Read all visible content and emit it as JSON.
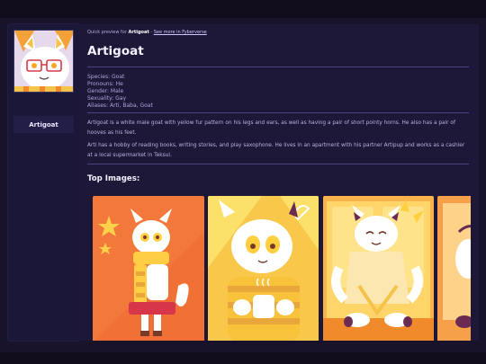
{
  "sidebar": {
    "character_name": "Artigoat"
  },
  "breadcrumb": {
    "prefix": "Quick preview for",
    "name": "Artigoat",
    "separator": " - ",
    "link": "See more in Fyberverse"
  },
  "character": {
    "name": "Artigoat",
    "facts": [
      "Species: Goat",
      "Pronouns: He",
      "Gender: Male",
      "Sexuality: Gay",
      "Aliases: Arti, Baba, Goat"
    ],
    "description_1": "Artigoat is a white male goat with yellow fur pattern on his legs and ears, as well as having a pair of short pointy horns. He also has a pair of hooves as his feet.",
    "description_2": "Arti has a hobby of reading books, writing stories, and play saxophone. He lives in an apartment with his partner Artipup and works as a cashier at a local supermarket in Teksul."
  },
  "gallery": {
    "title": "Top Images:"
  },
  "colors": {
    "accent": "#ff8a3c",
    "background": "#1d1838",
    "text": "#b9b1e0"
  }
}
